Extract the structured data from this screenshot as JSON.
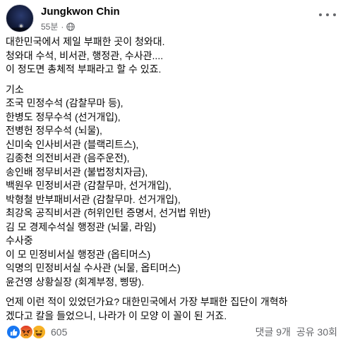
{
  "post": {
    "author": "Jungkwon Chin",
    "time": "55분",
    "separator": "·",
    "privacy_icon": "globe-icon",
    "menu_icon": "more-options-icon",
    "lines": [
      "대한민국에서 제일 부패한 곳이 청와대.",
      "청와대 수석, 비서관, 행정관, 수사관....",
      "이 정도면 총체적 부패라고 할 수 있죠.",
      "",
      "기소",
      "조국 민정수석 (감찰무마 등),",
      "한병도 정무수석 (선거개입),",
      "전병헌 정무수석 (뇌물),",
      "신미숙 인사비서관 (블랙리트스),",
      "김종천 의전비서관 (음주운전),",
      "송인배 정무비서관  (불법정치자금),",
      "백원우 민정비서관 (감찰무마, 선거개입),",
      "박형철 반부패비서관 (감찰무마. 선거개입),",
      "최강옥 공직비서관 (허위인턴 증명서, 선거법 위반)",
      "김 모 경제수석실 행정관 (뇌물, 라임)",
      "수사중",
      "이 모 민정비서실 행정관 (옵티머스)",
      "익명의 민정비서실 수사관 (뇌물, 옵티머스)",
      "윤건영 상황실장 (회계부정, 삥땅).",
      "",
      "언제 이런 적이 있었던가요? 대한민국에서 가장 부패한 집단이 개혁하",
      "겠다고 칼을 들었으니, 나라가 이 모양 이 꼴이 된 거죠."
    ]
  },
  "footer": {
    "reaction_icons": [
      "like-icon",
      "angry-icon",
      "haha-icon"
    ],
    "reaction_count": "605",
    "comments": "댓글 9개",
    "shares": "공유 30회"
  },
  "colors": {
    "text": "#050505",
    "secondary": "#65676b",
    "like": "#1877f2",
    "angry": "#e9710f",
    "haha": "#f7b125"
  }
}
